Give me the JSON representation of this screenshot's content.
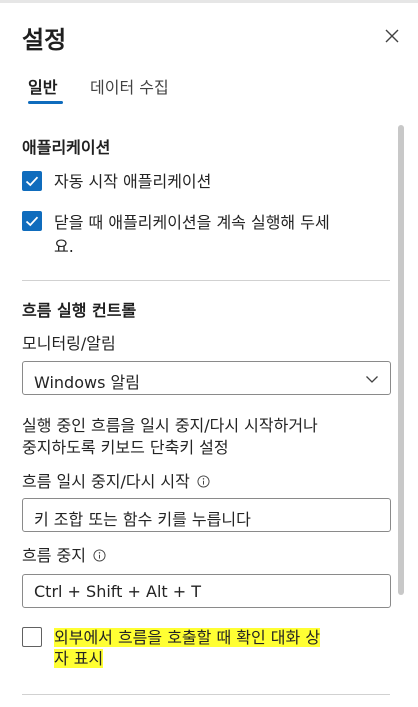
{
  "panel": {
    "title": "설정",
    "close_icon": "close-icon"
  },
  "tabs": [
    {
      "label": "일반",
      "active": true
    },
    {
      "label": "데이터 수집",
      "active": false
    }
  ],
  "apps": {
    "heading": "애플리케이션",
    "options": [
      {
        "label": "자동 시작 애플리케이션",
        "checked": true
      },
      {
        "label_line1": "닫을 때 애플리케이션을 계속 실행해 두세",
        "label_line2": "요.",
        "checked": true
      }
    ]
  },
  "flow": {
    "heading": "흐름 실행 컨트롤",
    "monitoring_label": "모니터링/알림",
    "monitoring_value": "Windows 알림",
    "shortcut_desc_line1": "실행 중인 흐름을 일시 중지/다시 시작하거나",
    "shortcut_desc_line2": "중지하도록 키보드 단축키 설정",
    "pause_label": "흐름 일시 중지/다시 시작",
    "pause_value": "키 조합 또는 함수 키를 누릅니다",
    "stop_label": "흐름 중지",
    "stop_value": "Ctrl + Shift + Alt + T",
    "confirm_line1": "외부에서 흐름을 호출할 때 확인 대화 상",
    "confirm_line2": "자 표시",
    "confirm_checked": false
  },
  "colors": {
    "accent": "#0f6cbd",
    "highlight": "#ffff33"
  }
}
